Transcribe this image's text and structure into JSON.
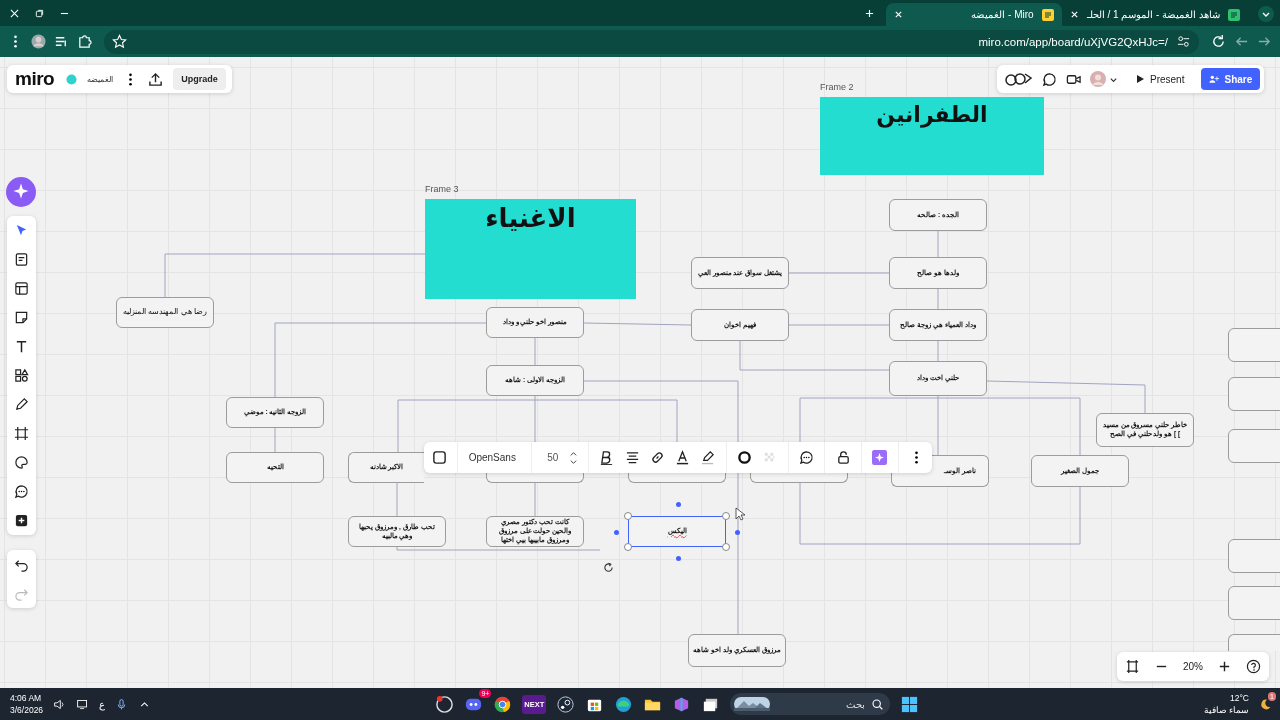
{
  "tabs": [
    {
      "title": "شاهد الغميضة - الموسم 1 / الحلـ",
      "selected": false
    },
    {
      "title": "الغميضه - Miro",
      "selected": true
    }
  ],
  "address_bar": {
    "url": "miro.com/app/board/uXjVG2QxHJc=/"
  },
  "board": {
    "logo": "miro",
    "name": "الغميضه",
    "upgrade_label": "Upgrade"
  },
  "top_right": {
    "present_label": "Present",
    "share_label": "Share"
  },
  "frames": [
    {
      "label": "Frame 2",
      "title": "الطفرانين"
    },
    {
      "label": "Frame 3",
      "title": "الاغنياء"
    }
  ],
  "nodes": [
    {
      "text": "الجده : صالحه",
      "selected": false
    },
    {
      "text": "ولدها هو صالح",
      "selected": false
    },
    {
      "text": "يشتغل سواق عند منصور العي",
      "selected": false
    },
    {
      "text": "وداد العمياء هي زوجة صالح",
      "selected": false
    },
    {
      "text": "فهيم اخوان",
      "selected": false
    },
    {
      "text": "منصور اخو حلني و وداد",
      "selected": false
    },
    {
      "text": "رضا هي المهندسه المنزليه",
      "selected": false
    },
    {
      "text": "حلني اخت وداد",
      "selected": false
    },
    {
      "text": "الزوجه الاولى : شاهه",
      "selected": false
    },
    {
      "text": "خاطر حلني مسروق من مسيد ] هو ولد حلني في الصح [",
      "selected": false
    },
    {
      "text": "الزوجه الثانيه : موضي",
      "selected": false
    },
    {
      "text": "جمول الصغير",
      "selected": false
    },
    {
      "text": "ناصر الوسـ",
      "selected": false
    },
    {
      "text": "الاكبر شادنه",
      "selected": false
    },
    {
      "text": "التحيه",
      "selected": false
    },
    {
      "text": "اليكس",
      "selected": true
    },
    {
      "text": "كانت تحب دكتور مصري والحين حولت على مرزوق ومرزوق مابيبها بيي اختها",
      "selected": false
    },
    {
      "text": "تحب طارق , ومرزوق يحبها وهي مالبيه",
      "selected": false
    },
    {
      "text": "مرزوق العسكري ولد اخو شاهه",
      "selected": false
    }
  ],
  "format_toolbar": {
    "font": "OpenSans",
    "size": "50"
  },
  "zoom": {
    "level_text": "20%"
  },
  "taskbar": {
    "time": "4:06 AM",
    "date": "3/6/2026",
    "ime": "ع",
    "discord_badge": "9+",
    "next_app_label": "NEXT",
    "search_placeholder": "بحث",
    "weather_badge": "1",
    "temperature": "12°C",
    "weather": "سماء صافية"
  }
}
